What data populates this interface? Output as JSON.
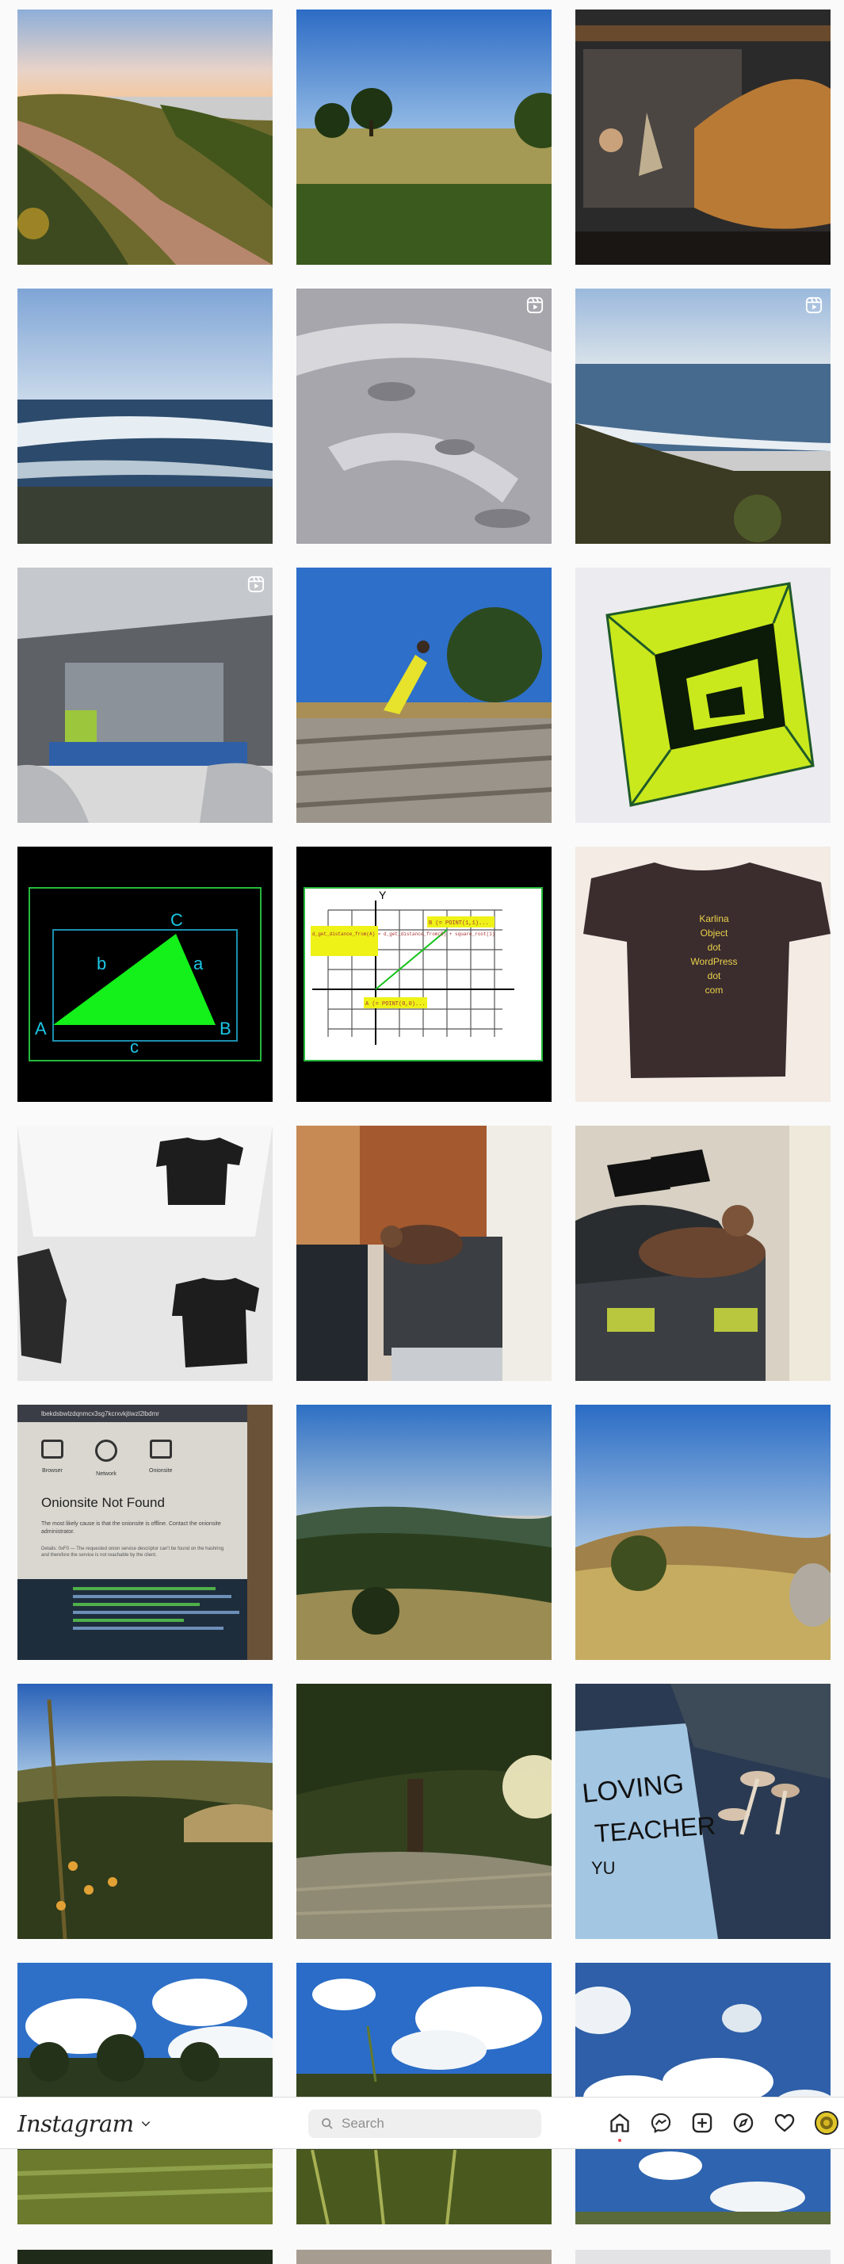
{
  "navbar": {
    "logo_text": "Instagram",
    "search_placeholder": "Search"
  },
  "tiles": [
    {
      "row": 1,
      "col": 1,
      "subject": "dirt path along hillside at sunset"
    },
    {
      "row": 1,
      "col": 2,
      "subject": "grassy meadow with oak trees"
    },
    {
      "row": 1,
      "col": 3,
      "subject": "stone fireplace with leather chair"
    },
    {
      "row": 2,
      "col": 1,
      "subject": "ocean waves on beach"
    },
    {
      "row": 2,
      "col": 2,
      "subject": "footprints in sand",
      "reel": true
    },
    {
      "row": 2,
      "col": 3,
      "subject": "coastal cliffs and ocean",
      "reel": true
    },
    {
      "row": 3,
      "col": 1,
      "subject": "empty train car interior",
      "reel": true
    },
    {
      "row": 3,
      "col": 2,
      "subject": "person doing yoga pose on driftwood"
    },
    {
      "row": 3,
      "col": 3,
      "subject": "green ink drawing of nested cubes"
    },
    {
      "row": 4,
      "col": 1,
      "subject": "green triangle diagram"
    },
    {
      "row": 4,
      "col": 2,
      "subject": "distance formula graph"
    },
    {
      "row": 4,
      "col": 3,
      "subject": "brown t-shirt with text"
    },
    {
      "row": 5,
      "col": 1,
      "subject": "three black t-shirts on white walls"
    },
    {
      "row": 5,
      "col": 2,
      "subject": "cat sleeping on storage bin"
    },
    {
      "row": 5,
      "col": 3,
      "subject": "cat sleeping on bin with shoes"
    },
    {
      "row": 6,
      "col": 1,
      "subject": "laptop screen showing error"
    },
    {
      "row": 6,
      "col": 2,
      "subject": "forested hills panorama"
    },
    {
      "row": 6,
      "col": 3,
      "subject": "golden grass hills"
    },
    {
      "row": 7,
      "col": 1,
      "subject": "wildflowers on hillside"
    },
    {
      "row": 7,
      "col": 2,
      "subject": "sun through oak tree"
    },
    {
      "row": 7,
      "col": 3,
      "subject": "handwritten note with mushrooms"
    },
    {
      "row": 8,
      "col": 1,
      "subject": "clouds over trees"
    },
    {
      "row": 8,
      "col": 2,
      "subject": "clouds over meadow"
    },
    {
      "row": 8,
      "col": 3,
      "subject": "clouds in blue sky"
    }
  ],
  "diagram_triangle": {
    "labels": [
      "A",
      "B",
      "C",
      "a",
      "b",
      "c"
    ]
  },
  "diagram_graph": {
    "box1": "d_get_distance_from(A) = d_get_distance_from(B) + square_root(1)",
    "box2": "B (= POINT(1,1)...",
    "box3": "A (= POINT(0,0)...",
    "axis_x": "X",
    "axis_y": "Y"
  },
  "tshirt": {
    "lines": [
      "Karlina",
      "Object",
      "dot",
      "WordPress",
      "dot",
      "com"
    ]
  },
  "laptop": {
    "title": "Onionsite Not Found",
    "url": "lbekdsbwlzdqnmcx3sg7kcrxvkjtiwzl2lbdmr",
    "icons": [
      "Browser",
      "Network",
      "Onionsite"
    ],
    "body": "The most likely cause is that the onionsite is offline. Contact the onionsite administrator.",
    "detail": "Details: 0xF0 — The requested onion service descriptor can't be found on the hashring and therefore the service is not reachable by the client."
  },
  "note": {
    "lines": [
      "LOVING",
      "TEACHER",
      "YU"
    ]
  },
  "colors": {
    "nav_border": "#dbdbdb",
    "text": "#262626",
    "search_bg": "#efefef",
    "notif": "#ed4956"
  }
}
